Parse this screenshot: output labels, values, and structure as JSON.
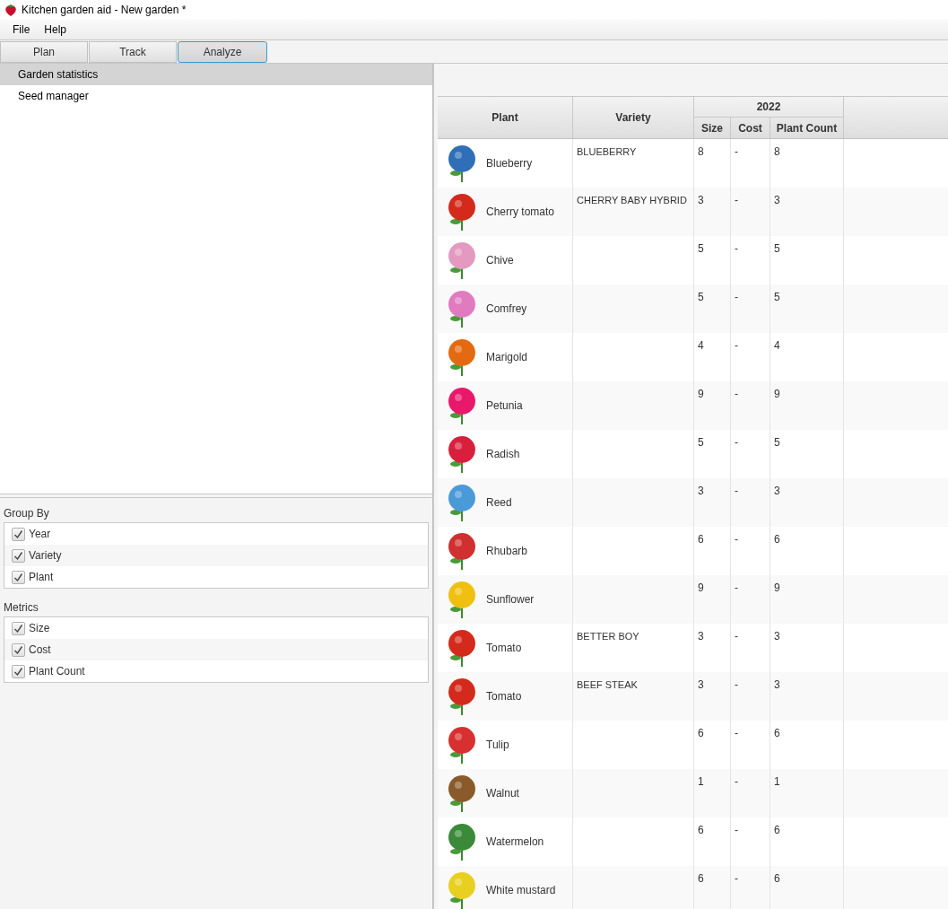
{
  "window": {
    "title": "Kitchen garden aid - New garden *"
  },
  "menu": [
    "File",
    "Help"
  ],
  "tabs": [
    {
      "label": "Plan",
      "selected": false
    },
    {
      "label": "Track",
      "selected": false
    },
    {
      "label": "Analyze",
      "selected": true
    }
  ],
  "nav": [
    {
      "label": "Garden statistics",
      "selected": true
    },
    {
      "label": "Seed manager",
      "selected": false
    }
  ],
  "option_groups": [
    {
      "title": "Group By",
      "items": [
        {
          "label": "Year",
          "checked": true
        },
        {
          "label": "Variety",
          "checked": true
        },
        {
          "label": "Plant",
          "checked": true
        }
      ]
    },
    {
      "title": "Metrics",
      "items": [
        {
          "label": "Size",
          "checked": true
        },
        {
          "label": "Cost",
          "checked": true
        },
        {
          "label": "Plant Count",
          "checked": true
        }
      ]
    }
  ],
  "table": {
    "columns": [
      "Plant",
      "Variety"
    ],
    "group": "2022",
    "sub_columns": [
      "Size",
      "Cost",
      "Plant Count"
    ],
    "rows": [
      {
        "plant": "Blueberry",
        "color": "#2f6fb8",
        "variety": "BLUEBERRY",
        "size": "8",
        "cost": "-",
        "count": "8"
      },
      {
        "plant": "Cherry tomato",
        "color": "#d42a1c",
        "variety": "CHERRY BABY HYBRID",
        "size": "3",
        "cost": "-",
        "count": "3"
      },
      {
        "plant": "Chive",
        "color": "#e49ac0",
        "variety": "",
        "size": "5",
        "cost": "-",
        "count": "5"
      },
      {
        "plant": "Comfrey",
        "color": "#e07bc0",
        "variety": "",
        "size": "5",
        "cost": "-",
        "count": "5"
      },
      {
        "plant": "Marigold",
        "color": "#e46a12",
        "variety": "",
        "size": "4",
        "cost": "-",
        "count": "4"
      },
      {
        "plant": "Petunia",
        "color": "#e8186a",
        "variety": "",
        "size": "9",
        "cost": "-",
        "count": "9"
      },
      {
        "plant": "Radish",
        "color": "#d8203c",
        "variety": "",
        "size": "5",
        "cost": "-",
        "count": "5"
      },
      {
        "plant": "Reed",
        "color": "#4a9ad8",
        "variety": "",
        "size": "3",
        "cost": "-",
        "count": "3"
      },
      {
        "plant": "Rhubarb",
        "color": "#d03030",
        "variety": "",
        "size": "6",
        "cost": "-",
        "count": "6"
      },
      {
        "plant": "Sunflower",
        "color": "#f0c010",
        "variety": "",
        "size": "9",
        "cost": "-",
        "count": "9"
      },
      {
        "plant": "Tomato",
        "color": "#d42a1c",
        "variety": "BETTER BOY",
        "size": "3",
        "cost": "-",
        "count": "3"
      },
      {
        "plant": "Tomato",
        "color": "#d42a1c",
        "variety": "BEEF STEAK",
        "size": "3",
        "cost": "-",
        "count": "3"
      },
      {
        "plant": "Tulip",
        "color": "#d83030",
        "variety": "",
        "size": "6",
        "cost": "-",
        "count": "6"
      },
      {
        "plant": "Walnut",
        "color": "#8a5a2a",
        "variety": "",
        "size": "1",
        "cost": "-",
        "count": "1"
      },
      {
        "plant": "Watermelon",
        "color": "#3a8a3a",
        "variety": "",
        "size": "6",
        "cost": "-",
        "count": "6"
      },
      {
        "plant": "White mustard",
        "color": "#e8d020",
        "variety": "",
        "size": "6",
        "cost": "-",
        "count": "6"
      }
    ]
  }
}
